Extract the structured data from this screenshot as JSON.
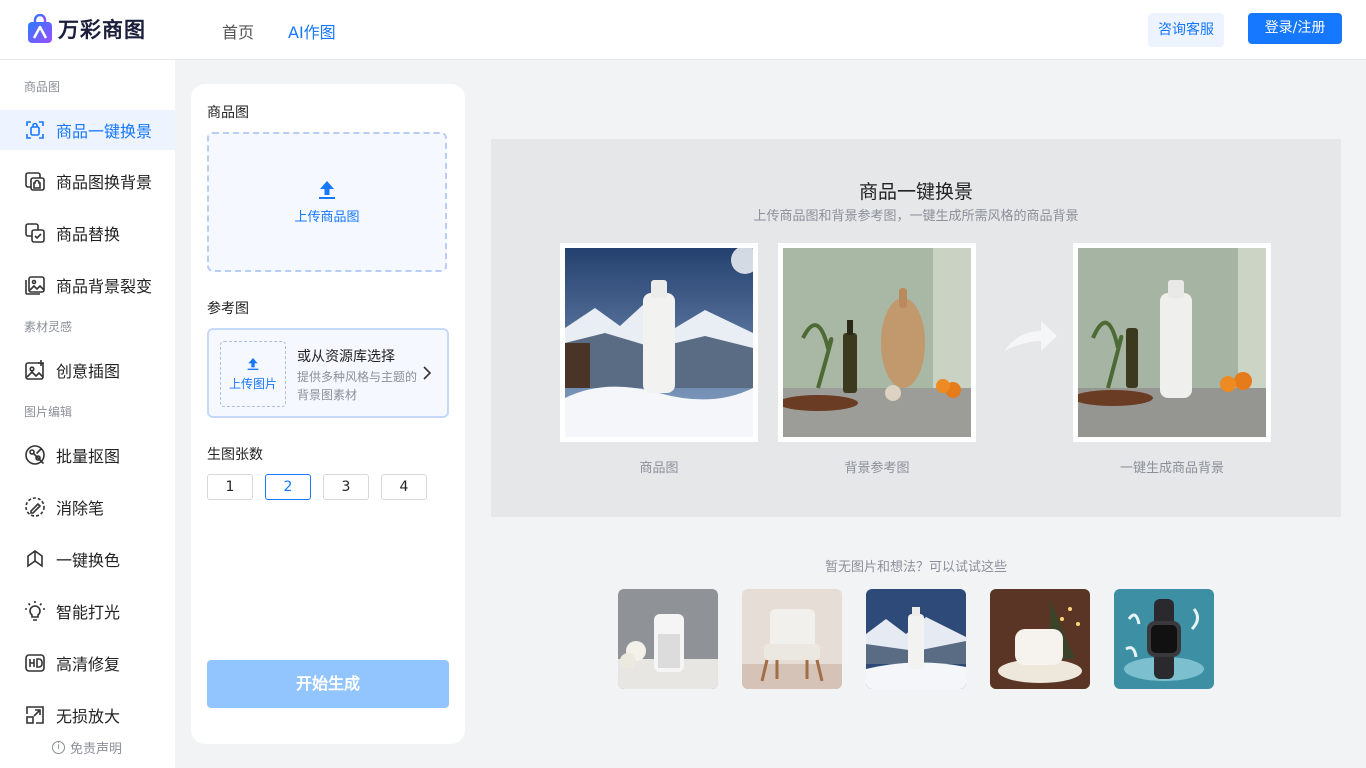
{
  "brand": {
    "name": "万彩商图"
  },
  "nav": [
    {
      "label": "首页",
      "active": false
    },
    {
      "label": "AI作图",
      "active": true
    }
  ],
  "header": {
    "consult": "咨询客服",
    "login": "登录/注册"
  },
  "sidebar": {
    "groups": [
      "商品图",
      "素材灵感",
      "图片编辑"
    ],
    "items": [
      {
        "label": "商品一键换景",
        "icon": "scene-swap-icon",
        "active": true
      },
      {
        "label": "商品图换背景",
        "icon": "background-swap-icon"
      },
      {
        "label": "商品替换",
        "icon": "product-replace-icon"
      },
      {
        "label": "商品背景裂变",
        "icon": "image-variation-icon"
      },
      {
        "label": "创意插图",
        "icon": "creative-illustration-icon"
      },
      {
        "label": "批量抠图",
        "icon": "batch-cutout-icon"
      },
      {
        "label": "消除笔",
        "icon": "eraser-pen-icon"
      },
      {
        "label": "一键换色",
        "icon": "recolor-icon"
      },
      {
        "label": "智能打光",
        "icon": "bulb-icon"
      },
      {
        "label": "高清修复",
        "icon": "hd-icon"
      },
      {
        "label": "无损放大",
        "icon": "enlarge-icon"
      }
    ],
    "disclaimer": "免责声明"
  },
  "panel": {
    "product_label": "商品图",
    "upload_product": "上传商品图",
    "reference_label": "参考图",
    "upload_image": "上传图片",
    "library_title": "或从资源库选择",
    "library_desc": "提供多种风格与主题的背景图素材",
    "count_label": "生图张数",
    "counts": [
      "1",
      "2",
      "3",
      "4"
    ],
    "selected_count": "2",
    "start": "开始生成"
  },
  "showcase": {
    "title": "商品一键换景",
    "subtitle": "上传商品图和背景参考图，一键生成所需风格的商品背景",
    "captions": [
      "商品图",
      "背景参考图",
      "一键生成商品背景"
    ]
  },
  "try": {
    "text": "暂无图片和想法？可以试试这些"
  },
  "colors": {
    "accent": "#1677ff",
    "start_disabled": "#92c5fd"
  }
}
